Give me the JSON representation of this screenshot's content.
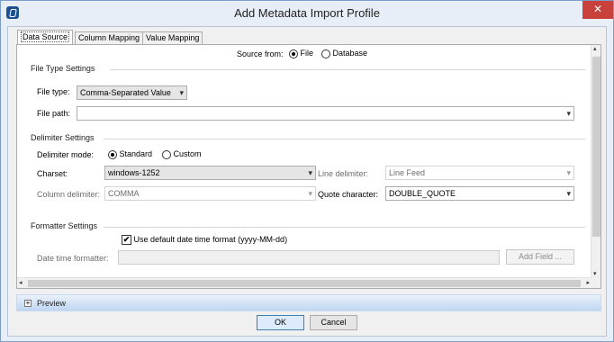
{
  "window": {
    "title": "Add Metadata Import Profile",
    "close": "✕"
  },
  "tabs": [
    "Data Source",
    "Column Mapping",
    "Value Mapping"
  ],
  "source": {
    "label": "Source from:",
    "options": [
      "File",
      "Database"
    ],
    "selected": "File"
  },
  "file_type_settings": {
    "title": "File Type Settings",
    "file_type_label": "File type:",
    "file_type_value": "Comma-Separated Value",
    "file_path_label": "File path:",
    "file_path_value": ""
  },
  "delimiter_settings": {
    "title": "Delimiter Settings",
    "mode_label": "Delimiter mode:",
    "modes": [
      "Standard",
      "Custom"
    ],
    "selected_mode": "Standard",
    "charset_label": "Charset:",
    "charset_value": "windows-1252",
    "line_delimiter_label": "Line delimiter:",
    "line_delimiter_value": "Line Feed",
    "column_delimiter_label": "Column delimiter:",
    "column_delimiter_value": "COMMA",
    "quote_character_label": "Quote character:",
    "quote_character_value": "DOUBLE_QUOTE"
  },
  "formatter_settings": {
    "title": "Formatter Settings",
    "use_default_label": "Use default date time format (yyyy-MM-dd)",
    "use_default_checked": true,
    "date_formatter_label": "Date time formatter:",
    "date_formatter_value": "",
    "add_field_label": "Add Field ..."
  },
  "preview": {
    "label": "Preview"
  },
  "buttons": {
    "ok": "OK",
    "cancel": "Cancel"
  },
  "icons": {
    "app": "app-icon",
    "chevron": "▾",
    "check": "✔",
    "expand": "+",
    "up": "▴",
    "down": "▾",
    "left": "◂",
    "right": "▸"
  }
}
